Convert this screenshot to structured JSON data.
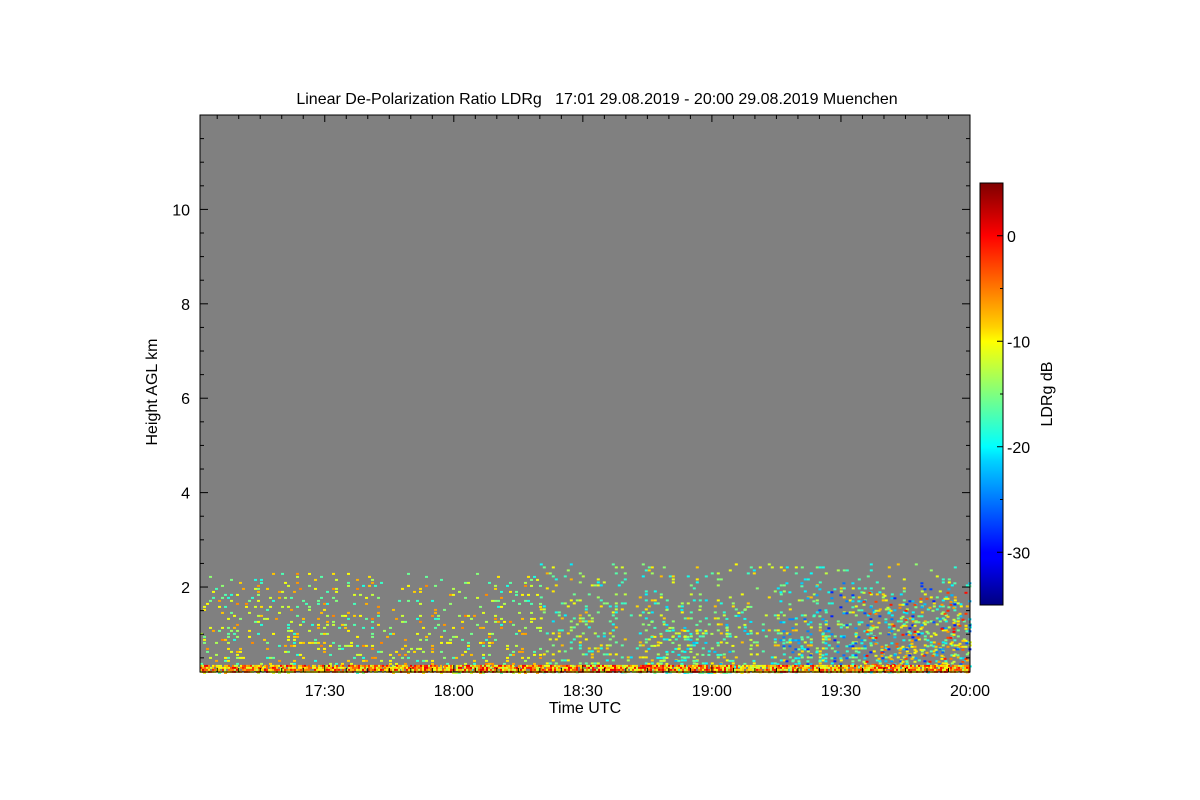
{
  "chart_data": {
    "type": "heatmap",
    "title": "Linear De-Polarization Ratio LDRg   17:01 29.08.2019 - 20:00 29.08.2019 Muenchen",
    "xlabel": "Time UTC",
    "ylabel": "Height AGL km",
    "colorbar_label": "LDRg dB",
    "x_ticks": [
      "17:30",
      "18:00",
      "18:30",
      "19:00",
      "19:30",
      "20:00"
    ],
    "x_tick_minutes": [
      1050,
      1080,
      1110,
      1140,
      1170,
      1200
    ],
    "xlim_minutes": [
      1021,
      1200
    ],
    "y_ticks": [
      2,
      4,
      6,
      8,
      10
    ],
    "ylim": [
      0.2,
      12.0
    ],
    "colorbar_ticks": [
      0,
      -10,
      -20,
      -30
    ],
    "colorbar_range": [
      -35,
      5
    ],
    "background_color": "#808080",
    "colormap": "jet",
    "signal_layers": [
      {
        "t_start": "17:01",
        "t_end": "18:20",
        "top_km": 2.3,
        "value_db": -12
      },
      {
        "t_start": "18:20",
        "t_end": "20:00",
        "top_km": 2.5,
        "value_db": -14
      },
      {
        "t_start": "19:15",
        "t_end": "20:00",
        "top_km": 2.1,
        "value_db": -22
      },
      {
        "t_start": "19:35",
        "t_end": "20:00",
        "top_km": 1.9,
        "value_db": -7
      },
      {
        "t_start": "18:45",
        "t_end": "19:10",
        "top_km": 1.6,
        "value_db": -16
      },
      {
        "t_start": "17:01",
        "t_end": "20:00",
        "top_km": 0.35,
        "value_db": -6
      }
    ]
  }
}
